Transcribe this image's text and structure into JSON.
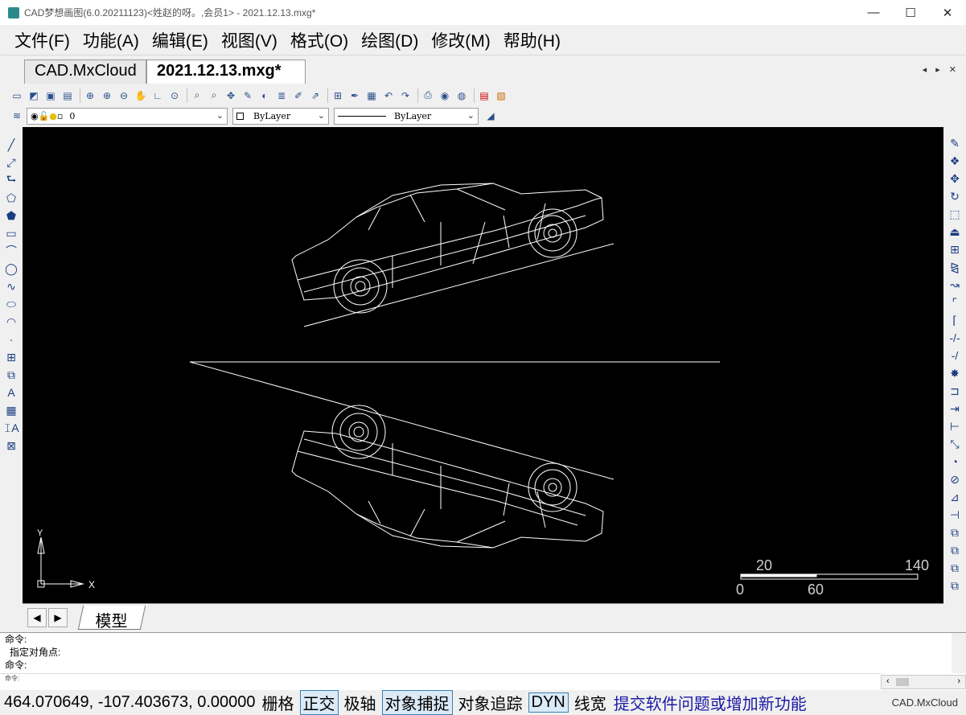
{
  "window": {
    "title": "CAD梦想画图(6.0.20211123)<姓赵的呀。,会员1> - 2021.12.13.mxg*",
    "minimize": "—",
    "maximize": "☐",
    "close": "✕"
  },
  "menu": [
    "文件(F)",
    "功能(A)",
    "编辑(E)",
    "视图(V)",
    "格式(O)",
    "绘图(D)",
    "修改(M)",
    "帮助(H)"
  ],
  "tabs": [
    {
      "label": "CAD.MxCloud",
      "active": false
    },
    {
      "label": "2021.12.13.mxg*",
      "active": true
    }
  ],
  "tab_nav": "◂ ▸ ✕",
  "properties": {
    "layer_value": "0",
    "color_value": "ByLayer",
    "linetype_value": "ByLayer"
  },
  "drawing": {
    "background": "#000000",
    "stroke": "#ffffff",
    "ucs_y_label": "Y",
    "ucs_x_label": "X",
    "scale_top_labels": [
      "20",
      "140"
    ],
    "scale_bottom_labels": [
      "0",
      "60"
    ]
  },
  "layout": {
    "prev": "◀",
    "next": "▶",
    "model_tab": "模型"
  },
  "command": {
    "lines": [
      "命令:",
      "  指定对角点:",
      "命令:"
    ],
    "input_prompt": "命令:"
  },
  "status": {
    "coords": "464.070649,  -107.403673,  0.00000",
    "buttons": [
      {
        "label": "栅格",
        "on": false
      },
      {
        "label": "正交",
        "on": true
      },
      {
        "label": "极轴",
        "on": false
      },
      {
        "label": "对象捕捉",
        "on": true
      },
      {
        "label": "对象追踪",
        "on": false
      },
      {
        "label": "DYN",
        "on": true
      },
      {
        "label": "线宽",
        "on": false
      }
    ],
    "feedback": "提交软件问题或增加新功能",
    "brand": "CAD.MxCloud"
  }
}
